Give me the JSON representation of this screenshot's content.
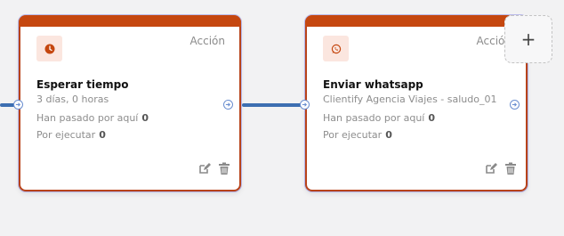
{
  "nodes": [
    {
      "type_label": "Acción",
      "title": "Esperar tiempo",
      "subtitle": "3 días, 0 horas",
      "passed_label": "Han pasado por aquí",
      "passed_count": "0",
      "pending_label": "Por ejecutar",
      "pending_count": "0",
      "icon": "clock-icon"
    },
    {
      "type_label": "Acción",
      "title": "Enviar whatsapp",
      "subtitle": "Clientify Agencia Viajes - saludo_01",
      "passed_label": "Han pasado por aquí",
      "passed_count": "0",
      "pending_label": "Por ejecutar",
      "pending_count": "0",
      "icon": "whatsapp-icon"
    }
  ],
  "add_button": {
    "label": "+"
  },
  "colors": {
    "card_accent": "#c5470f",
    "badge_bg": "#fbe6df",
    "connector": "#3d6fb1",
    "handle": "#6b8fd0"
  }
}
